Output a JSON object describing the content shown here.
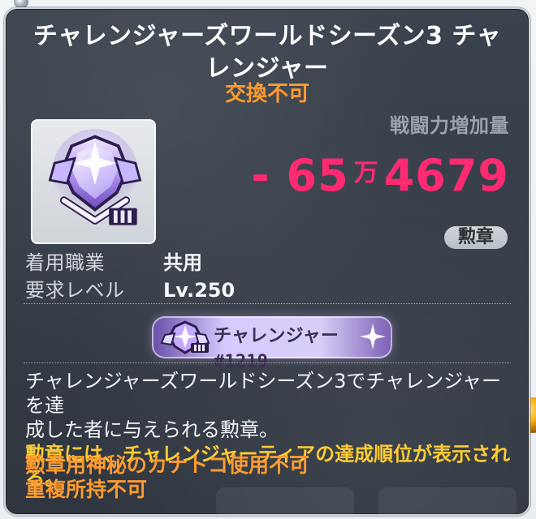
{
  "tooltip": {
    "title": "チャレンジャーズワールドシーズン3 チャレンジャー",
    "trade_status": "交換不可",
    "combat_power": {
      "label": "戦闘力増加量",
      "sign": "-",
      "value_main": "65",
      "unit": "万",
      "value_rest": "4679"
    },
    "category": "勲章",
    "stats": [
      {
        "key": "着用職業",
        "value": "共用"
      },
      {
        "key": "要求レベル",
        "value": "Lv.250"
      }
    ],
    "medal_tag": {
      "text": "チャレンジャー#1219"
    },
    "description": {
      "line1": "チャレンジャーズワールドシーズン3でチャレンジャーを達",
      "line2": "成した者に与えられる勲章。",
      "line3": "勲章には、チャレンジャーティアの達成順位が表示される。"
    },
    "notes": {
      "line1": "勲章用神秘のカナトコ使用不可",
      "line2": "重複所持不可"
    }
  },
  "colors": {
    "title": "#ffffff",
    "trade_status": "#ff9b2f",
    "combat_power": "#ff2a72",
    "highlight": "#ffcc33",
    "note": "#ff9b2f",
    "panel_bg": "#343b45"
  },
  "icons": {
    "medal": "challenger-medal-icon",
    "tag_medal": "challenger-tag-medal-icon",
    "tag_sparkle": "sparkle-icon"
  }
}
